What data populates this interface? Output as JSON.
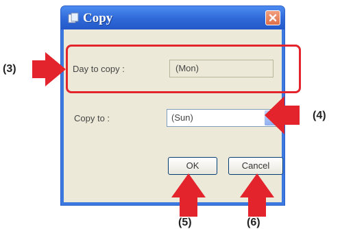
{
  "dialog": {
    "title": "Copy",
    "day_to_copy_label": "Day to copy :",
    "day_to_copy_value": "(Mon)",
    "copy_to_label": "Copy to :",
    "copy_to_value": "(Sun)",
    "ok_label": "OK",
    "cancel_label": "Cancel",
    "icons": {
      "app": "copy-app-icon",
      "close": "close-icon",
      "dropdown": "chevron-down-icon"
    }
  },
  "annotations": {
    "marker_3": "(3)",
    "marker_4": "(4)",
    "marker_5": "(5)",
    "marker_6": "(6)",
    "colors": {
      "arrow": "#e4242c",
      "highlight_box": "#e4242c"
    }
  }
}
